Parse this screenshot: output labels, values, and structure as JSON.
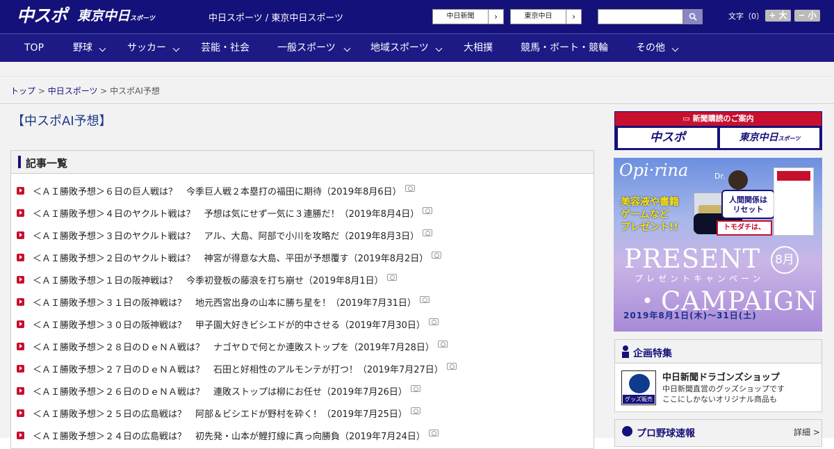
{
  "header": {
    "logo_main": "中スポ",
    "logo_tokyo": "東京中日",
    "logo_tokyo_small": "スポーツ",
    "site_name": "中日スポーツ / 東京中日スポーツ",
    "paper_buttons": [
      "中日新聞",
      "東京中日"
    ],
    "search_placeholder": "",
    "font_size_label": "文字（0）",
    "font_plus": "+ 大",
    "font_minus": "− 小"
  },
  "nav": {
    "items": [
      "TOP",
      "野球",
      "サッカー",
      "芸能・社会",
      "一般スポーツ",
      "地域スポーツ",
      "大相撲",
      "競馬・ボート・競輪",
      "その他"
    ]
  },
  "breadcrumb": {
    "home": "トップ",
    "section": "中日スポーツ",
    "current": "中スポAI予想",
    "sep": " > "
  },
  "page_title": "【中スポAI予想】",
  "articles": {
    "heading": "記事一覧",
    "items": [
      "＜ＡＩ勝敗予想＞６日の巨人戦は？　今季巨人戦２本塁打の福田に期待（2019年8月6日）",
      "＜ＡＩ勝敗予想＞４日のヤクルト戦は？　予想は気にせず一気に３連勝だ！（2019年8月4日）",
      "＜ＡＩ勝敗予想＞３日のヤクルト戦は？　アル、大島、阿部で小川を攻略だ（2019年8月3日）",
      "＜ＡＩ勝敗予想＞２日のヤクルト戦は？　神宮が得意な大島、平田が予想覆す（2019年8月2日）",
      "＜ＡＩ勝敗予想＞１日の阪神戦は？　今季初登板の藤浪を打ち崩せ（2019年8月1日）",
      "＜ＡＩ勝敗予想＞３１日の阪神戦は？　地元西宮出身の山本に勝ち星を！（2019年7月31日）",
      "＜ＡＩ勝敗予想＞３０日の阪神戦は？　甲子園大好きビシエドが的中させる（2019年7月30日）",
      "＜ＡＩ勝敗予想＞２８日のＤｅＮＡ戦は？　ナゴヤＤで何とか連敗ストップを（2019年7月28日）",
      "＜ＡＩ勝敗予想＞２７日のＤｅＮＡ戦は？　石田と好相性のアルモンテが打つ！（2019年7月27日）",
      "＜ＡＩ勝敗予想＞２６日のＤｅＮＡ戦は？　連敗ストップは柳にお任せ（2019年7月26日）",
      "＜ＡＩ勝敗予想＞２５日の広島戦は？　阿部＆ビシエドが野村を砕く！（2019年7月25日）",
      "＜ＡＩ勝敗予想＞２４日の広島戦は？　初先発・山本が鯉打線に真っ向勝負（2019年7月24日）"
    ]
  },
  "sidebar": {
    "subscribe": {
      "title": "新聞購読のご案内",
      "logos": [
        "中スポ",
        "東京中日"
      ],
      "small": "スポーツ"
    },
    "ad": {
      "brand": "Opi·rina",
      "yellow": "美容液や書籍\nゲームなど\nプレゼント!!",
      "present": "PRESENT",
      "month": "8月",
      "kana": "プレゼントキャンペーン",
      "campaign": "・CAMPAIGN",
      "dates": "2019年8月1日(木)〜31日(土)",
      "speech": "人間関係は\nリセット",
      "speech2": "トモダチは、",
      "dr": "Dr."
    },
    "kikaku": {
      "title": "企画特集",
      "shop_badge": "グッズ販売中",
      "shop_name": "中日新聞ドラゴンズショップ",
      "shop_desc": "中日新聞直営のグッズショップです\nここにしかないオリジナル商品も"
    },
    "pro": {
      "title": "プロ野球速報",
      "more": "詳細 >"
    }
  },
  "colors": {
    "header_bg": "#15117a",
    "nav_bg": "#1d1a86",
    "accent_red": "#c8102e",
    "link": "#15117a"
  }
}
